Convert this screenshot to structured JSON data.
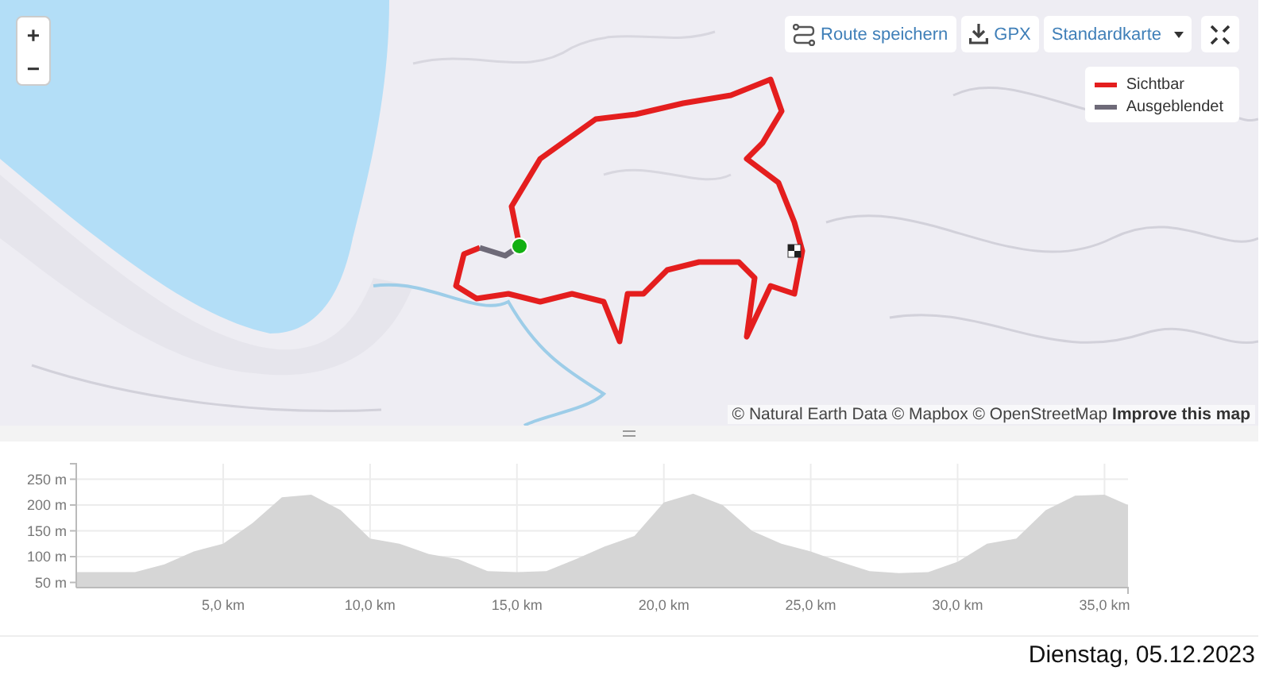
{
  "map": {
    "zoom_controls": [
      "+",
      "−"
    ],
    "toolbar": {
      "save_route": "Route speichern",
      "gpx": "GPX",
      "map_style": "Standardkarte"
    },
    "legend": [
      {
        "label": "Sichtbar",
        "color": "#e41e1e"
      },
      {
        "label": "Ausgeblendet",
        "color": "#6e6a78"
      }
    ],
    "attribution": "© Natural Earth Data © Mapbox © OpenStreetMap",
    "improve_link": "Improve this map"
  },
  "elevation_chart": {
    "chart_data": {
      "type": "area",
      "x": [
        0,
        1,
        2,
        3,
        4,
        5,
        6,
        7,
        8,
        9,
        10,
        11,
        12,
        13,
        14,
        15,
        16,
        17,
        18,
        19,
        20,
        21,
        22,
        23,
        24,
        25,
        26,
        27,
        28,
        29,
        30,
        31,
        32,
        33,
        34,
        35,
        35.8
      ],
      "grid": true,
      "series": [
        {
          "color": "#d6d6d6",
          "values": [
            70,
            70,
            70,
            85,
            110,
            125,
            165,
            215,
            220,
            190,
            135,
            125,
            105,
            95,
            72,
            70,
            72,
            95,
            120,
            140,
            205,
            222,
            200,
            150,
            125,
            110,
            90,
            72,
            68,
            70,
            90,
            125,
            135,
            190,
            218,
            220,
            200
          ]
        }
      ],
      "xlim": [
        0,
        35.8
      ],
      "ylim": [
        40,
        280
      ],
      "xticks": [
        {
          "value": 5,
          "label": "5,0 km"
        },
        {
          "value": 10,
          "label": "10,0 km"
        },
        {
          "value": 15,
          "label": "15,0 km"
        },
        {
          "value": 20,
          "label": "20,0 km"
        },
        {
          "value": 25,
          "label": "25,0 km"
        },
        {
          "value": 30,
          "label": "30,0 km"
        },
        {
          "value": 35,
          "label": "35,0 km"
        }
      ],
      "yticks": [
        {
          "value": 50,
          "label": "50 m"
        },
        {
          "value": 100,
          "label": "100 m"
        },
        {
          "value": 150,
          "label": "150 m"
        },
        {
          "value": 200,
          "label": "200 m"
        },
        {
          "value": 250,
          "label": "250 m"
        }
      ]
    }
  },
  "date": "Dienstag, 05.12.2023"
}
